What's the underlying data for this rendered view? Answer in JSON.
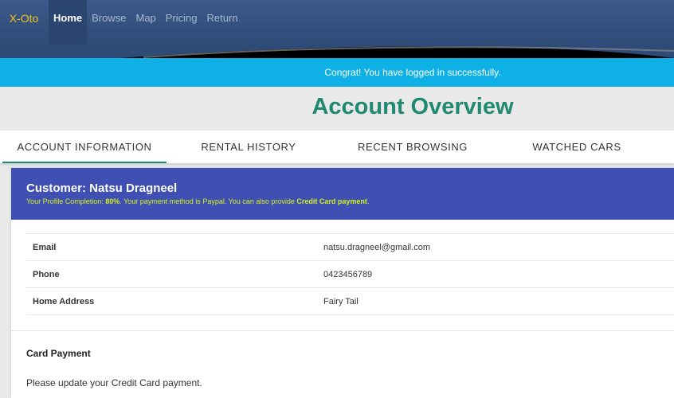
{
  "navbar": {
    "brand": "X-Oto",
    "links": [
      "Home",
      "Browse",
      "Map",
      "Pricing",
      "Return"
    ]
  },
  "alert": {
    "message": "Congrat! You have logged in successfully."
  },
  "page": {
    "title": "Account Overview"
  },
  "tabs": [
    "ACCOUNT INFORMATION",
    "RENTAL HISTORY",
    "RECENT BROWSING",
    "WATCHED CARS"
  ],
  "customer": {
    "title": "Customer: Natsu Dragneel",
    "sub_prefix": "Your Profile Completion: ",
    "completion": "80%",
    "sub_mid": ". Your payment method is Paypal. You can also provide ",
    "sub_strong": "Credit Card payment",
    "sub_suffix": "."
  },
  "info": {
    "rows": [
      {
        "label": "Email",
        "value": "natsu.dragneel@gmail.com"
      },
      {
        "label": "Phone",
        "value": "0423456789"
      },
      {
        "label": "Home Address",
        "value": "Fairy Tail"
      }
    ]
  },
  "card_payment": {
    "title": "Card Payment",
    "text": "Please update your Credit Card payment."
  },
  "colors": {
    "navbar": "#2e4b78",
    "alert": "#0fb0e6",
    "title": "#1f8a70",
    "customer_header": "#3f4fb4",
    "brand": "#f2c21b",
    "highlight": "#d4f21a"
  }
}
